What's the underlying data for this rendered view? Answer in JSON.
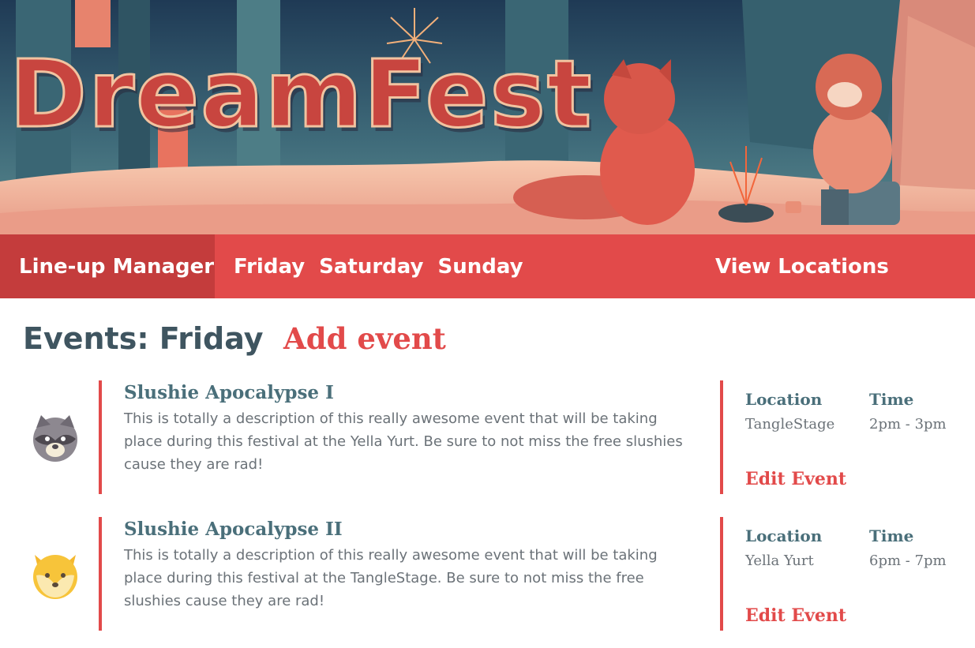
{
  "banner": {
    "title": "DreamFest"
  },
  "nav": {
    "brand": "Line-up Manager",
    "days": [
      "Friday",
      "Saturday",
      "Sunday"
    ],
    "locations": "View Locations"
  },
  "main": {
    "heading": "Events: Friday",
    "add_event": "Add event",
    "location_label": "Location",
    "time_label": "Time",
    "edit_label": "Edit Event",
    "events": [
      {
        "title": "Slushie Apocalypse I",
        "description": "This is totally a description of this really awesome event that will be taking place during this festival at the Yella Yurt. Be sure to not miss the free slushies cause they are rad!",
        "location": "TangleStage",
        "time": "2pm - 3pm",
        "avatar": "raccoon-avatar-icon"
      },
      {
        "title": "Slushie Apocalypse II",
        "description": "This is totally a description of this really awesome event that will be taking place during this festival at the TangleStage. Be sure to not miss the free slushies cause they are rad!",
        "location": "Yella Yurt",
        "time": "6pm - 7pm",
        "avatar": "fox-avatar-icon"
      }
    ]
  },
  "colors": {
    "accent": "#e24a4a",
    "accent_dark": "#c43c3c",
    "heading": "#3f5560",
    "title": "#4a6f7a",
    "body_text": "#6b7278"
  }
}
